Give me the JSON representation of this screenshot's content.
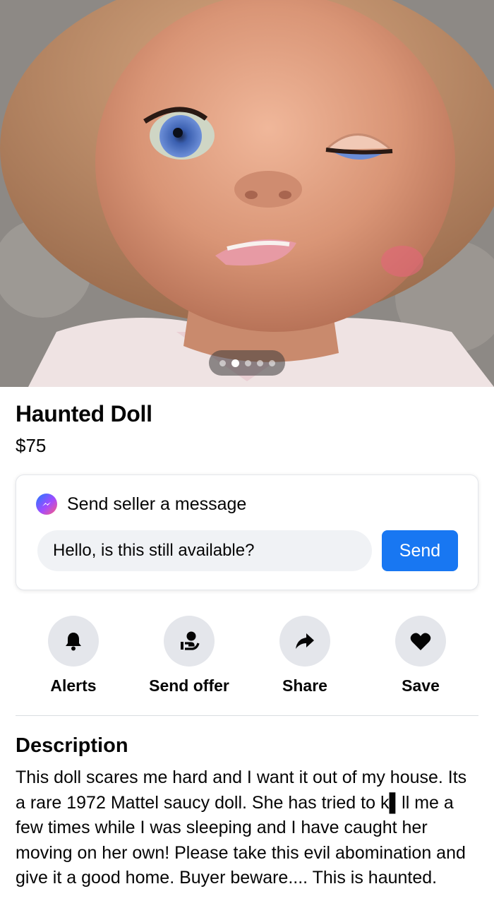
{
  "listing": {
    "title": "Haunted Doll",
    "price": "$75",
    "photo_pager": {
      "count": 5,
      "active_index": 1
    }
  },
  "message": {
    "header": "Send seller a message",
    "input_value": "Hello, is this still available?",
    "send_label": "Send"
  },
  "actions": [
    {
      "label": "Alerts",
      "icon": "bell-icon"
    },
    {
      "label": "Send offer",
      "icon": "offer-icon"
    },
    {
      "label": "Share",
      "icon": "share-arrow-icon"
    },
    {
      "label": "Save",
      "icon": "heart-icon"
    }
  ],
  "description": {
    "heading": "Description",
    "text": "This doll scares me hard and I want it out of my house. Its a rare 1972 Mattel saucy doll. She has tried to k▌ll me a few times while I was sleeping and I have caught her moving on her own! Please take this evil abomination and give it a good home. Buyer beware.... This is haunted."
  },
  "colors": {
    "accent": "#1877f2",
    "icon_bg": "#e4e6eb",
    "input_bg": "#f0f2f5"
  }
}
